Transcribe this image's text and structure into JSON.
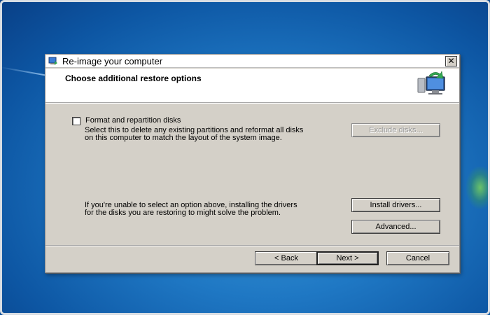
{
  "dialog": {
    "title": "Re-image your computer",
    "header_title": "Choose additional restore options",
    "close_glyph": "✕"
  },
  "options": {
    "format_label": "Format and repartition disks",
    "format_checked": false,
    "format_desc_line1": "Select this to delete any existing partitions and reformat all disks",
    "format_desc_line2": "on this computer to match the layout of the system image.",
    "exclude_disks_label": "Exclude disks...",
    "drivers_desc_line1": "If you're unable to select an option above, installing the drivers",
    "drivers_desc_line2": "for the disks you are restoring to might solve the problem.",
    "install_drivers_label": "Install drivers...",
    "advanced_label": "Advanced..."
  },
  "footer": {
    "back_label": "< Back",
    "next_label": "Next >",
    "cancel_label": "Cancel"
  },
  "icons": {
    "title_icon": "system-restore-icon",
    "header_icon": "computer-restore-icon"
  },
  "colors": {
    "desktop": "#1f78c4",
    "dialog_face": "#d4d0c8",
    "header_bg": "#ffffff"
  }
}
